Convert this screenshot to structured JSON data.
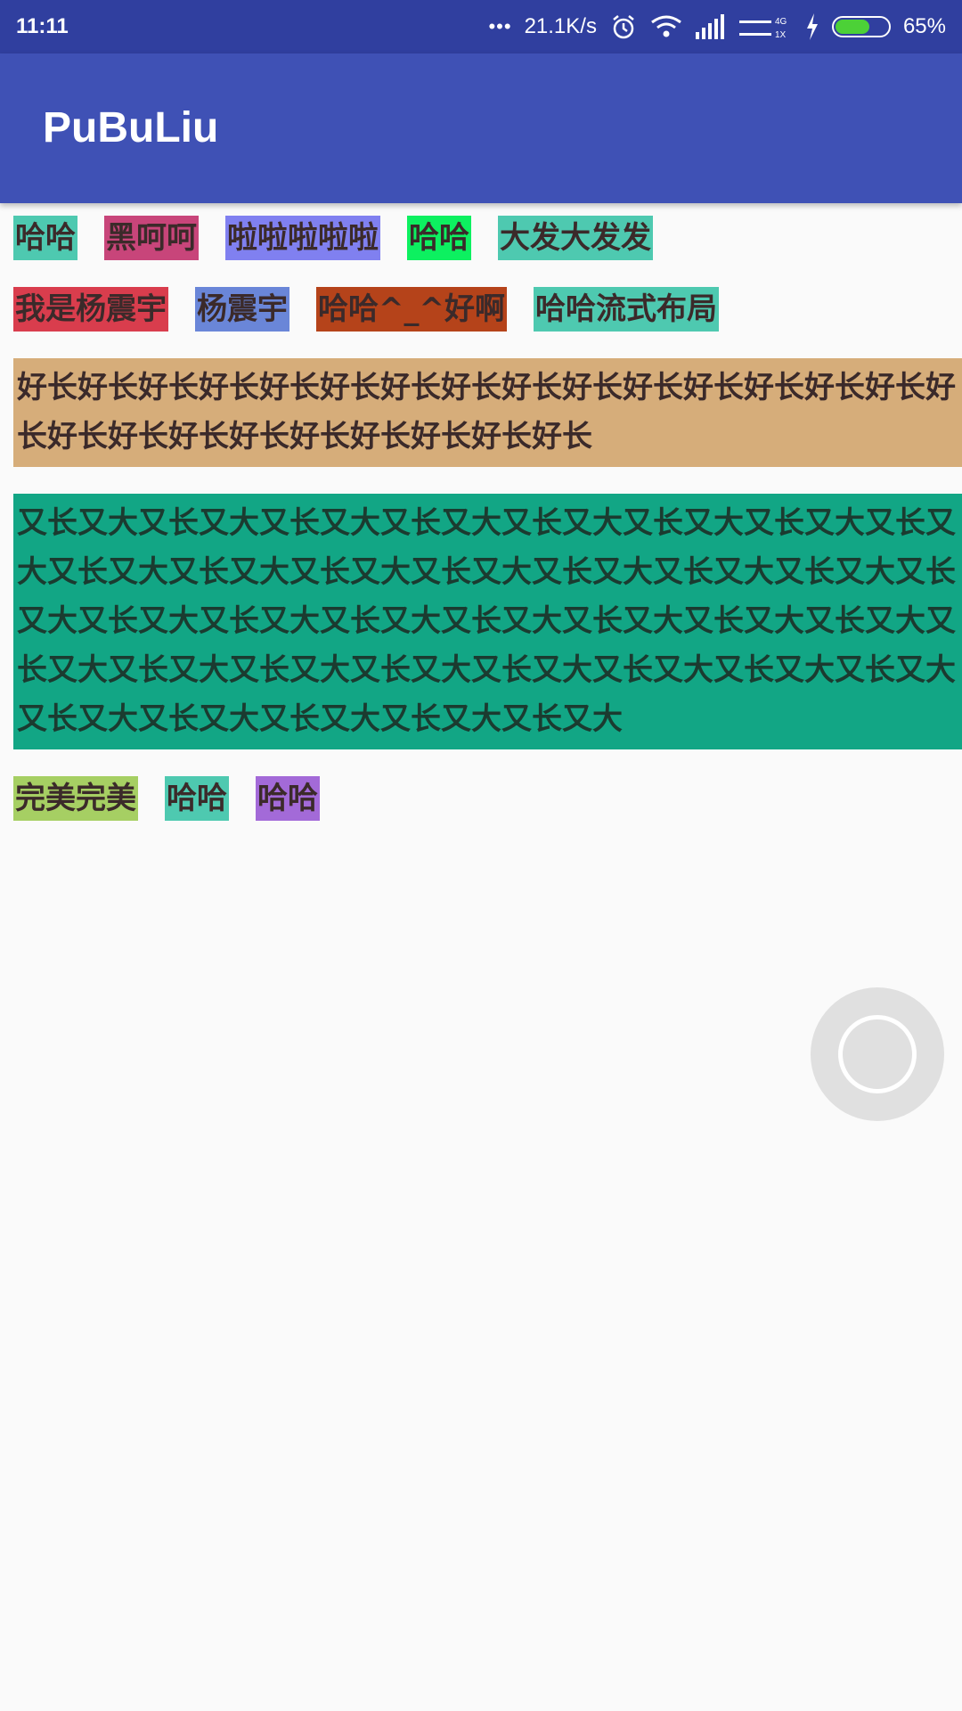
{
  "status_bar": {
    "time": "11:11",
    "dots": "•••",
    "net_speed": "21.1K/s",
    "battery_percent": "65%",
    "battery_level": 0.65,
    "icons": [
      "alarm-icon",
      "wifi-icon",
      "signal-icon",
      "signal-4g-icon",
      "charging-icon",
      "battery-icon"
    ]
  },
  "app_bar": {
    "title": "PuBuLiu"
  },
  "flow": {
    "tags": [
      {
        "text": "哈哈",
        "color": "#4ec9b0"
      },
      {
        "text": "黑呵呵",
        "color": "#c8457a"
      },
      {
        "text": "啦啦啦啦啦",
        "color": "#8080f0"
      },
      {
        "text": "哈哈",
        "color": "#0df060"
      },
      {
        "text": "大发大发发",
        "color": "#4ec9b0"
      },
      {
        "text": "我是杨震宇",
        "color": "#d93d4d"
      },
      {
        "text": "杨震宇",
        "color": "#6a86d8"
      },
      {
        "text": "哈哈^_^好啊",
        "color": "#b5431a"
      },
      {
        "text": "哈哈流式布局",
        "color": "#4ec9b0"
      },
      {
        "text": "好长好长好长好长好长好长好长好长好长好长好长好长好长好长好长好长好长好长好长好长好长好长好长好长好长",
        "color": "#d6ad7a"
      },
      {
        "text": "又长又大又长又大又长又大又长又大又长又大又长又大又长又大又长又大又长又大又长又大又长又大又长又大又长又大又长又大又长又大又长又大又长又大又长又大又长又大又长又大又长又大又长又大又长又大又长又大又长又大又长又大又长又大又长又大又长又大又长又大又长又大又长又大又长又大又长又大又长又大又长又大",
        "color": "#12a685"
      },
      {
        "text": "完美完美",
        "color": "#a6cf63"
      },
      {
        "text": "哈哈",
        "color": "#4ec9b0"
      },
      {
        "text": "哈哈",
        "color": "#a36ad8"
      }
    ]
  },
  "fab": {
    "icon": "circle-ring-icon"
  }
}
